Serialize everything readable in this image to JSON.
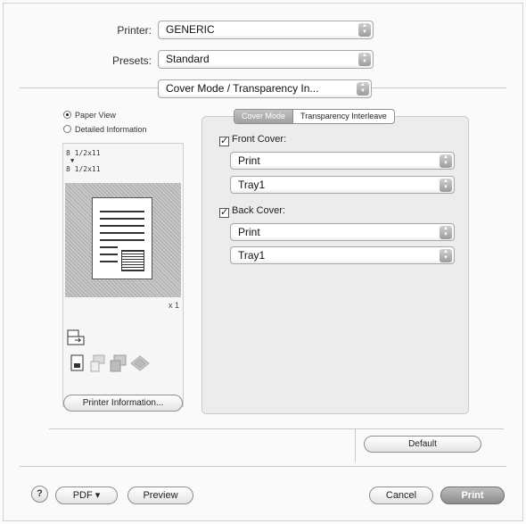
{
  "printer": {
    "label": "Printer:",
    "value": "GENERIC"
  },
  "presets": {
    "label": "Presets:",
    "value": "Standard"
  },
  "panel_select": {
    "value": "Cover Mode / Transparency In..."
  },
  "view": {
    "paper_view": "Paper View",
    "detailed_information": "Detailed Information",
    "selected": "paper_view"
  },
  "preview": {
    "size_top": "8 1/2x11",
    "size_bottom": "8 1/2x11",
    "copies": "x 1",
    "printer_info_button": "Printer Information..."
  },
  "tabs": [
    {
      "label": "Cover Mode",
      "active": true
    },
    {
      "label": "Transparency Interleave",
      "active": false
    }
  ],
  "front_cover": {
    "label": "Front Cover:",
    "checked": true,
    "mode": "Print",
    "tray": "Tray1"
  },
  "back_cover": {
    "label": "Back Cover:",
    "checked": true,
    "mode": "Print",
    "tray": "Tray1"
  },
  "buttons": {
    "default": "Default",
    "help": "?",
    "pdf": "PDF ▾",
    "preview": "Preview",
    "cancel": "Cancel",
    "print": "Print"
  }
}
